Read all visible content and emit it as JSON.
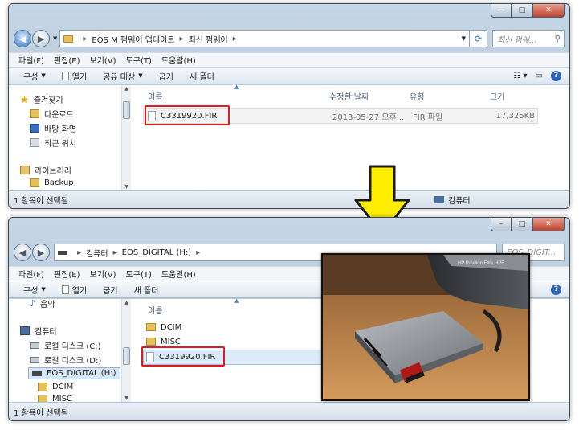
{
  "window1": {
    "address": [
      "EOS M 펌웨어 업데이트",
      "최신 펌웨어"
    ],
    "search_placeholder": "최신 펌웨...",
    "menu": [
      "파일(F)",
      "편집(E)",
      "보기(V)",
      "도구(T)",
      "도움말(H)"
    ],
    "toolbar": {
      "organize": "구성",
      "open": "열기",
      "share": "공유 대상",
      "burn": "굽기",
      "new_folder": "새 폴더"
    },
    "nav": {
      "favorites": "즐겨찾기",
      "downloads": "다운로드",
      "desktop": "바탕 화면",
      "recent": "최근 위치",
      "libraries": "라이브러리",
      "backup": "Backup"
    },
    "columns": {
      "name": "이름",
      "date": "수정한 날짜",
      "type": "유형",
      "size": "크기"
    },
    "file": {
      "name": "C3319920.FIR",
      "date": "2013-05-27 오후...",
      "type": "FIR 파일",
      "size": "17,325KB"
    },
    "status_left": "1 항목이 선택됨",
    "status_right": "컴퓨터"
  },
  "window2": {
    "address": [
      "컴퓨터",
      "EOS_DIGITAL (H:)"
    ],
    "search_placeholder": "EOS_DIGIT...",
    "menu": [
      "파일(F)",
      "편집(E)",
      "보기(V)",
      "도구(T)",
      "도움말(H)"
    ],
    "toolbar": {
      "organize": "구성",
      "open": "열기",
      "burn": "굽기",
      "new_folder": "새 폴더"
    },
    "nav": {
      "music": "음악",
      "computer": "컴퓨터",
      "local_c": "로컬 디스크 (C:)",
      "local_d": "로컬 디스크 (D:)",
      "eos_digital": "EOS_DIGITAL (H:)",
      "dcim": "DCIM",
      "misc": "MISC"
    },
    "columns": {
      "name": "이름"
    },
    "items": [
      "DCIM",
      "MISC",
      "C3319920.FIR"
    ],
    "status_left": "1 항목이 선택됨"
  },
  "photo_label": "HP Pavilion Elite HPE",
  "colors": {
    "highlight_box": "#e01b1b",
    "arrow_fill": "#ffee00",
    "accent": "#2a62b8"
  }
}
